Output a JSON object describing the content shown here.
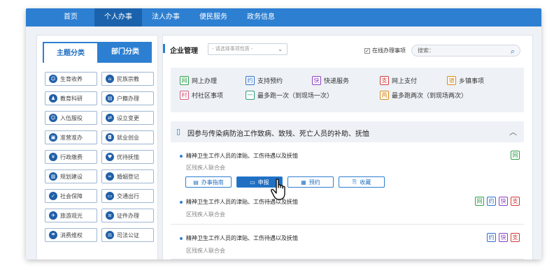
{
  "nav": {
    "items": [
      {
        "label": "首页"
      },
      {
        "label": "个人办事"
      },
      {
        "label": "法人办事"
      },
      {
        "label": "便民服务"
      },
      {
        "label": "政务信息"
      }
    ],
    "active_index": 1,
    "color": "#2d7fd1",
    "active_color": "#1b62ad"
  },
  "left_panel": {
    "tabs": [
      {
        "label": "主题分类",
        "active": true
      },
      {
        "label": "部门分类",
        "active": false
      }
    ],
    "categories": [
      {
        "label": "生育收养",
        "icon": "baby-icon"
      },
      {
        "label": "民族宗教",
        "icon": "temple-icon"
      },
      {
        "label": "教育科研",
        "icon": "people-icon"
      },
      {
        "label": "户籍办理",
        "icon": "id-card-icon"
      },
      {
        "label": "入伍服役",
        "icon": "smile-icon"
      },
      {
        "label": "设立变更",
        "icon": "change-icon"
      },
      {
        "label": "准营准办",
        "icon": "license-icon"
      },
      {
        "label": "就业创业",
        "icon": "briefcase-icon"
      },
      {
        "label": "行政缴费",
        "icon": "yen-icon"
      },
      {
        "label": "优待抚恤",
        "icon": "heart-icon"
      },
      {
        "label": "规划建设",
        "icon": "building-icon"
      },
      {
        "label": "婚姻登记",
        "icon": "rings-icon"
      },
      {
        "label": "社会保障",
        "icon": "shield-icon"
      },
      {
        "label": "交通出行",
        "icon": "bus-icon"
      },
      {
        "label": "旅游观光",
        "icon": "plane-icon"
      },
      {
        "label": "证件办理",
        "icon": "document-icon"
      },
      {
        "label": "消费维权",
        "icon": "umbrella-icon"
      },
      {
        "label": "司法公证",
        "icon": "gavel-icon"
      }
    ]
  },
  "main": {
    "title": "企业管理",
    "select_placeholder": "- 请选择事项性质 -",
    "online_checkbox_label": "在线办理事项",
    "online_checked": true,
    "search_label": "搜索：",
    "legend": [
      {
        "tag": "网",
        "label": "网上办理",
        "color": "#2f9f4c"
      },
      {
        "tag": "约",
        "label": "支持预约",
        "color": "#2d6fc8"
      },
      {
        "tag": "快",
        "label": "快递服务",
        "color": "#8a3fbf"
      },
      {
        "tag": "支",
        "label": "网上支付",
        "color": "#d03a3a"
      },
      {
        "tag": "镇",
        "label": "乡镇事项",
        "color": "#d88a1a"
      },
      {
        "tag": "村",
        "label": "村社区事项",
        "color": "#d45a7c"
      },
      {
        "tag": "一",
        "label": "最多跑一次（到现场一次）",
        "color": "#2aa07a"
      },
      {
        "tag": "两",
        "label": "最多跑两次（到现场两次）",
        "color": "#d88a1a"
      }
    ],
    "group_title": "因参与传染病防治工作致病、致残、死亡人员的补助、抚恤",
    "items": [
      {
        "title": "精神卫生工作人员的津贴、工伤待遇以及抚恤",
        "dept": "区残疾人联合会",
        "tags": [
          "网"
        ]
      },
      {
        "title": "精神卫生工作人员的津贴、工伤待遇以及抚恤",
        "dept": "区残疾人联合会",
        "tags": [
          "网",
          "约",
          "快",
          "支"
        ]
      },
      {
        "title": "精神卫生工作人员的津贴、工伤待遇以及抚恤",
        "dept": "区残疾人联合会",
        "tags": [
          "约",
          "快",
          "支"
        ]
      }
    ],
    "actions": [
      {
        "label": "办事指南",
        "icon": "guide-icon"
      },
      {
        "label": "申报",
        "icon": "monitor-icon"
      },
      {
        "label": "预约",
        "icon": "calendar-icon"
      },
      {
        "label": "收藏",
        "icon": "bookmark-icon"
      }
    ]
  }
}
